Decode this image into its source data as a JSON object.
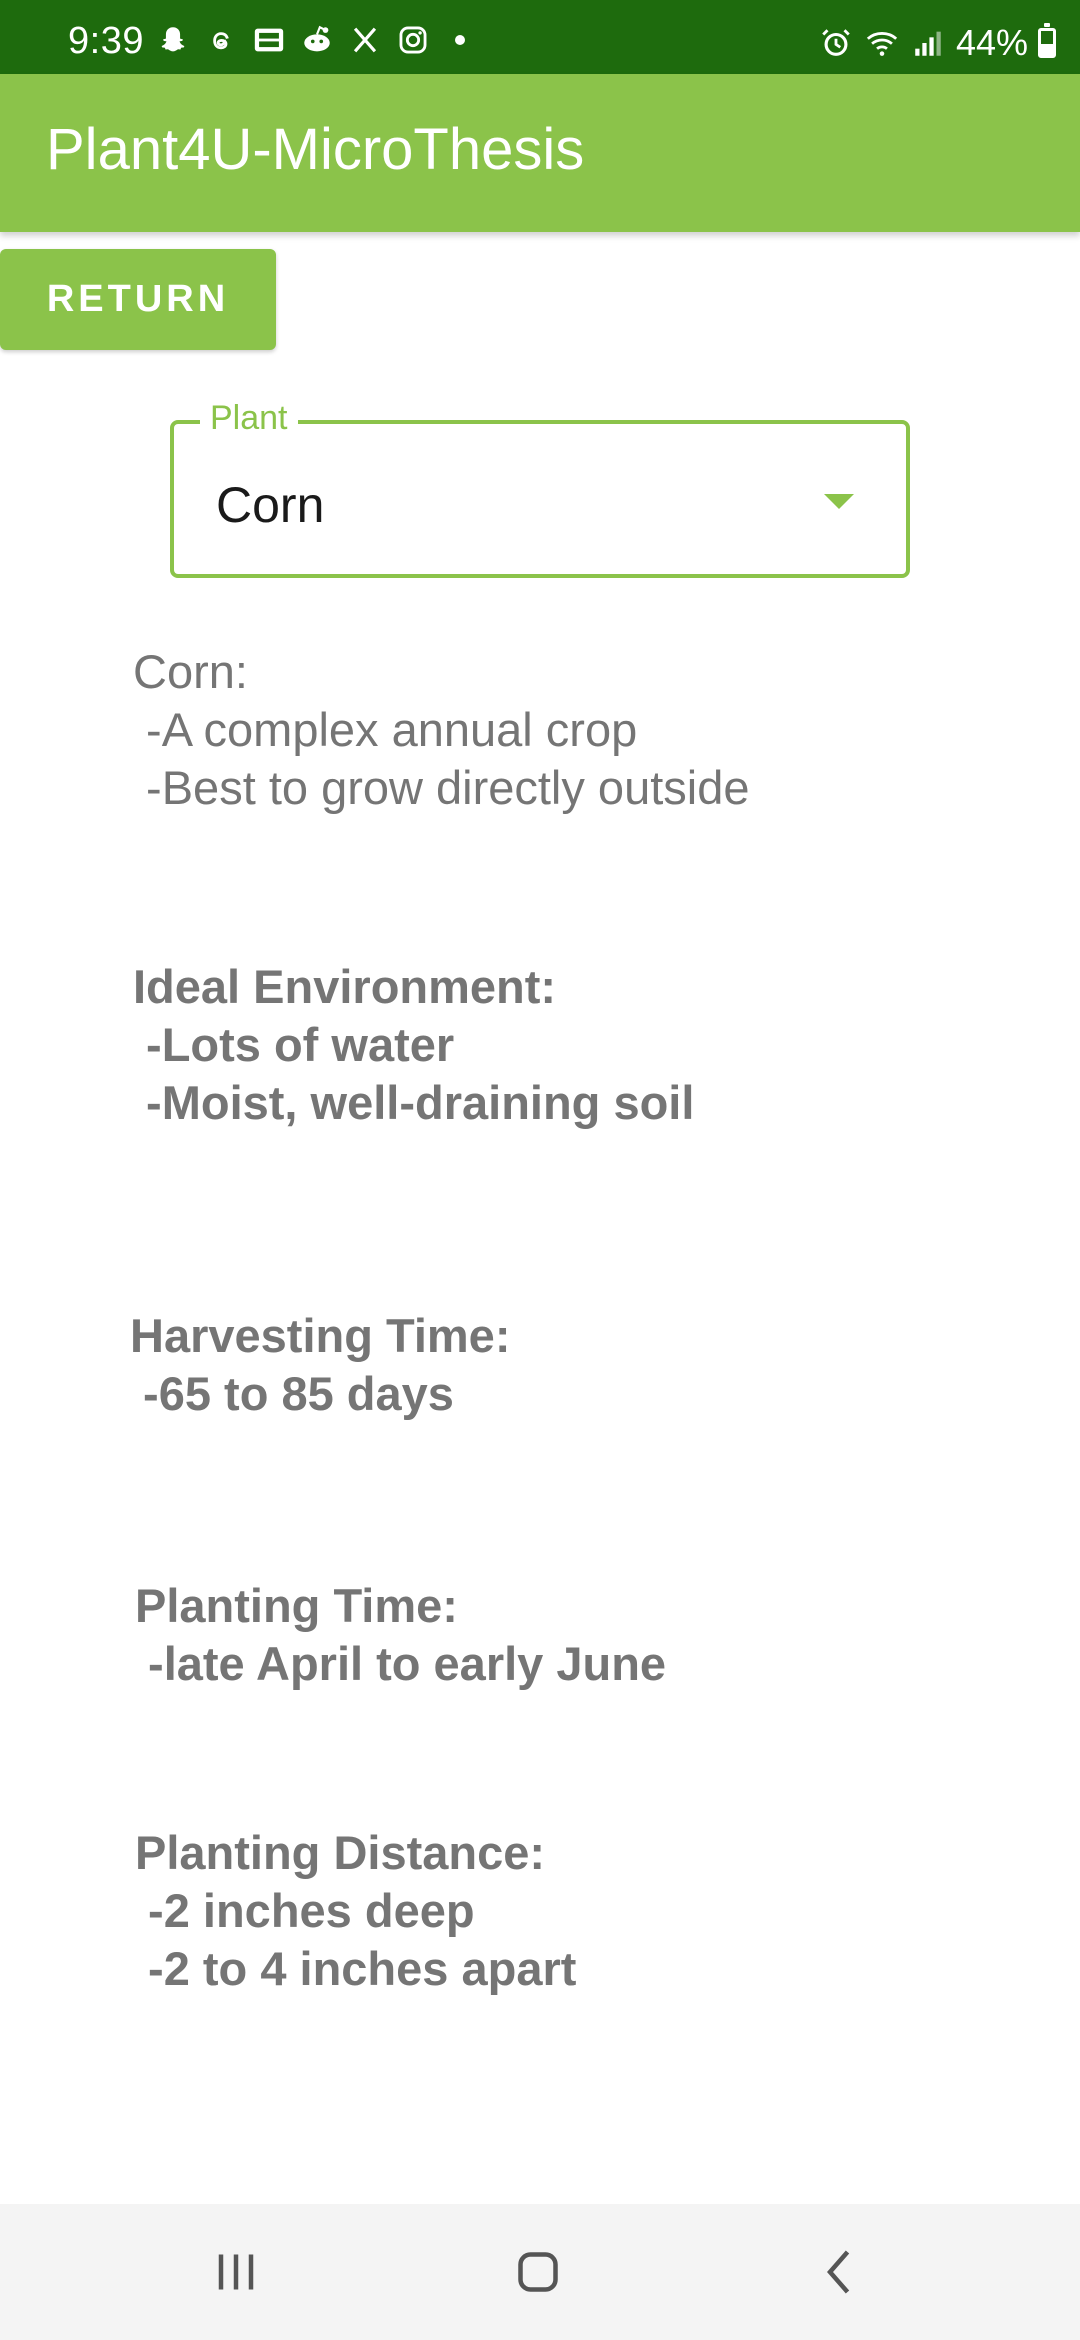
{
  "status_bar": {
    "time": "9:39",
    "battery": "44%",
    "battery_level": 0.44,
    "left_icons": [
      "snapchat-icon",
      "threads-icon",
      "webtoon-icon",
      "reddit-icon",
      "x-icon",
      "instagram-icon"
    ],
    "right_icons": [
      "alarm-icon",
      "wifi-icon",
      "signal-icon",
      "battery-icon"
    ]
  },
  "app_bar": {
    "title": "Plant4U-MicroThesis"
  },
  "return_button": {
    "label": "RETURN"
  },
  "plant_dropdown": {
    "label": "Plant",
    "selected": "Corn"
  },
  "info": {
    "description": "Corn:\n -A complex annual crop\n -Best to grow directly outside",
    "environment": "Ideal Environment:\n -Lots of water\n -Moist, well-draining soil",
    "harvesting": "Harvesting Time:\n -65 to 85 days",
    "planting_time": "Planting Time:\n -late April to early June",
    "planting_distance": "Planting Distance:\n -2 inches deep\n -2 to 4 inches apart"
  },
  "nav_bar": {
    "buttons": [
      "recent-apps-icon",
      "home-icon",
      "back-icon"
    ]
  },
  "colors": {
    "status_bar": "#1e6b0d",
    "accent": "#8bc34a",
    "body_text": "#757575"
  }
}
